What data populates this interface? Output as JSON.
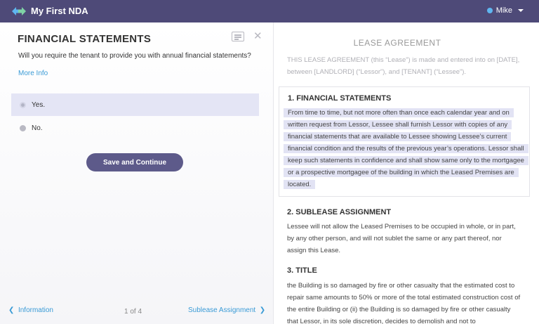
{
  "header": {
    "app_title": "My First NDA",
    "user_name": "Mike",
    "colors": {
      "bar": "#4e4a78",
      "logo_left": "#5fb6f0",
      "logo_right": "#7fd3a6",
      "user_dot": "#5fb6f0"
    }
  },
  "question": {
    "title": "FINANCIAL STATEMENTS",
    "text": "Will you require the tenant to provide you with annual financial statements?",
    "more_info": "More Info",
    "options": [
      {
        "label": "Yes.",
        "selected": true
      },
      {
        "label": "No.",
        "selected": false
      }
    ],
    "save_label": "Save and Continue",
    "icons": [
      "notes-icon",
      "close-icon"
    ]
  },
  "pager": {
    "prev_label": "Information",
    "count": "1 of 4",
    "next_label": "Sublease Assignment"
  },
  "document": {
    "title": "LEASE AGREEMENT",
    "intro": "THIS LEASE AGREEMENT (this “Lease”) is made and entered into on [DATE], between [LANDLORD] (“Lessor”), and [TENANT] (“Lessee”).",
    "sections": [
      {
        "heading": "1. FINANCIAL STATEMENTS",
        "body": "From time to time, but not more often than once each calendar year and on written request from Lessor, Lessee shall furnish Lessor with copies of any financial statements that are available to Lessee showing Lessee’s current financial condition and the results of the previous year’s operations.  Lessor shall keep such statements in confidence and shall show same only to the mortgagee or a prospective mortgagee of the building in which the Leased Premises are located."
      },
      {
        "heading": "2. SUBLEASE ASSIGNMENT",
        "body": "Lessee will not allow the Leased Premises to be occupied in whole, or in part, by any other person, and will not sublet the same or any part thereof, nor assign this Lease."
      },
      {
        "heading": "3. TITLE",
        "body": "the Building is so damaged by fire or other casualty that the estimated cost to repair same amounts to 50% or more of the total estimated construction cost of the entire Building or (ii) the Building is so damaged by fire or other casualty that Lessor, in its sole discretion, decides to demolish and not to"
      }
    ]
  }
}
